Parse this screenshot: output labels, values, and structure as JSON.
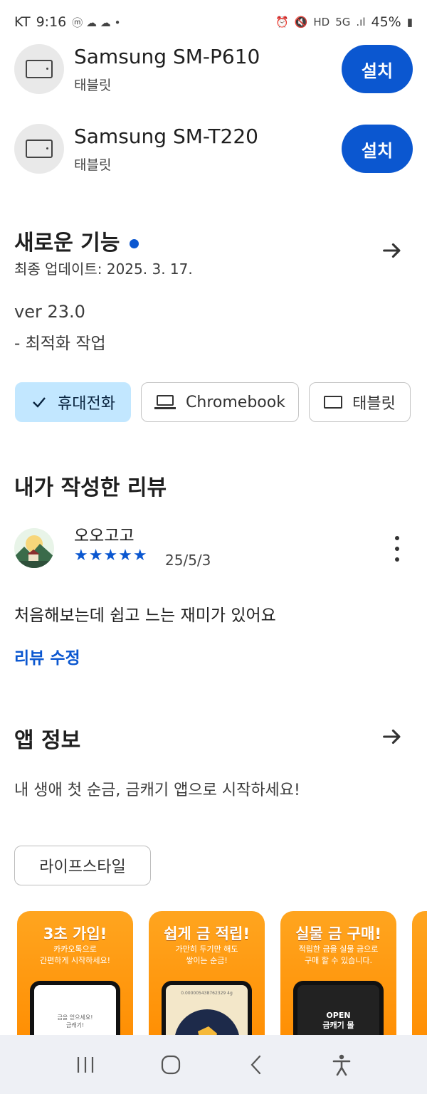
{
  "status_bar": {
    "carrier": "KT",
    "time": "9:16",
    "battery": "45%",
    "network": "5G"
  },
  "devices": [
    {
      "name": "Samsung SM-P610",
      "type": "태블릿",
      "button": "설치"
    },
    {
      "name": "Samsung SM-T220",
      "type": "태블릿",
      "button": "설치"
    }
  ],
  "whats_new": {
    "title": "새로운 기능",
    "updated": "최종 업데이트: 2025. 3. 17.",
    "version": "ver 23.0",
    "note": "- 최적화 작업"
  },
  "device_chips": [
    {
      "label": "휴대전화",
      "selected": true
    },
    {
      "label": "Chromebook",
      "selected": false
    },
    {
      "label": "태블릿",
      "selected": false
    }
  ],
  "my_review": {
    "title": "내가 작성한 리뷰",
    "reviewer": "오오고고",
    "rating": 5,
    "stars": "★★★★★",
    "date": "25/5/3",
    "text": "처음해보는데 쉽고 느는 재미가 있어요",
    "edit": "리뷰 수정"
  },
  "app_info": {
    "title": "앱 정보",
    "description": "내 생애 첫 순금, 금캐기 앱으로 시작하세요!",
    "category": "라이프스타일"
  },
  "screenshots": [
    {
      "title": "3초 가입!",
      "subtitle": "카카오톡으로\n간편하게 시작하세요!",
      "screen": "금을 얻으세요!\n금캐기!"
    },
    {
      "title": "쉽게 금 적립!",
      "subtitle": "가만히 두기만 해도\n쌓이는 순금!",
      "screen": "0.000005438762329 4g"
    },
    {
      "title": "실물 금 구매!",
      "subtitle": "적립한 금을 실물 금으로\n구매 할 수 있습니다.",
      "screen": "OPEN\n금캐기 몰"
    }
  ],
  "colors": {
    "accent": "#0b57d0",
    "chip_selected": "#c2e7ff",
    "screenshot_orange": "#ff9500"
  }
}
